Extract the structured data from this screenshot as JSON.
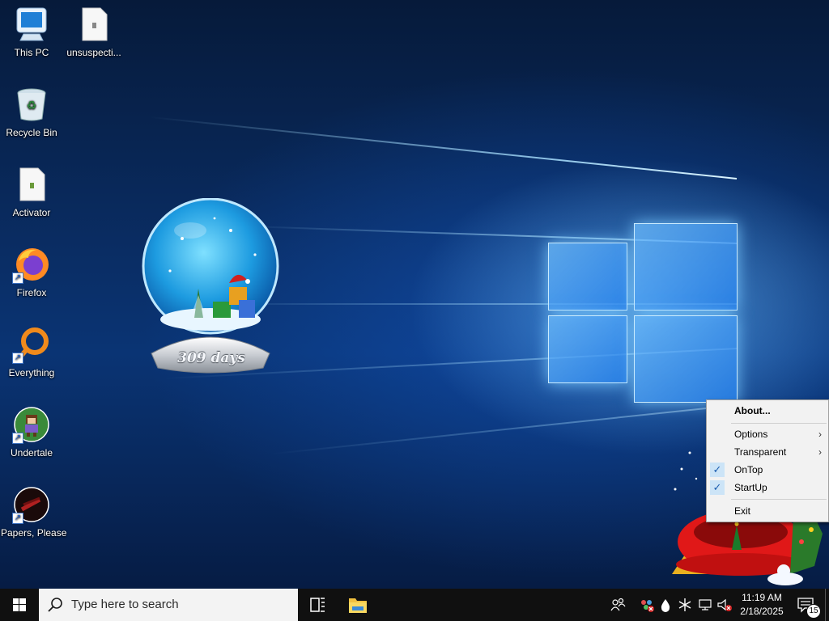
{
  "desktop": {
    "icons": [
      {
        "label": "This PC",
        "icon": "computer-icon"
      },
      {
        "label": "unsuspecti...",
        "icon": "file-icon"
      },
      {
        "label": "Recycle Bin",
        "icon": "recycle-bin-icon"
      },
      {
        "label": "Activator",
        "icon": "file-icon"
      },
      {
        "label": "Firefox",
        "icon": "firefox-icon"
      },
      {
        "label": "Everything",
        "icon": "everything-search-icon"
      },
      {
        "label": "Undertale",
        "icon": "undertale-icon"
      },
      {
        "label": "Papers, Please",
        "icon": "papers-please-icon"
      }
    ]
  },
  "snow_globe": {
    "countdown_label": "309 days"
  },
  "context_menu": {
    "items": [
      {
        "label": "About...",
        "bold": true
      },
      {
        "label": "Options",
        "submenu": true
      },
      {
        "label": "Transparent",
        "submenu": true
      },
      {
        "label": "OnTop",
        "checked": true
      },
      {
        "label": "StartUp",
        "checked": true
      },
      {
        "label": "Exit"
      }
    ],
    "submenu_glyph": "›",
    "check_glyph": "✓"
  },
  "taskbar": {
    "search_placeholder": "Type here to search",
    "clock_time": "11:19 AM",
    "clock_date": "2/18/2025",
    "notification_count": "15"
  },
  "colors": {
    "taskbar_bg": "#101010",
    "menu_bg": "#f2f2f2",
    "check_bg": "#cce4f7"
  }
}
